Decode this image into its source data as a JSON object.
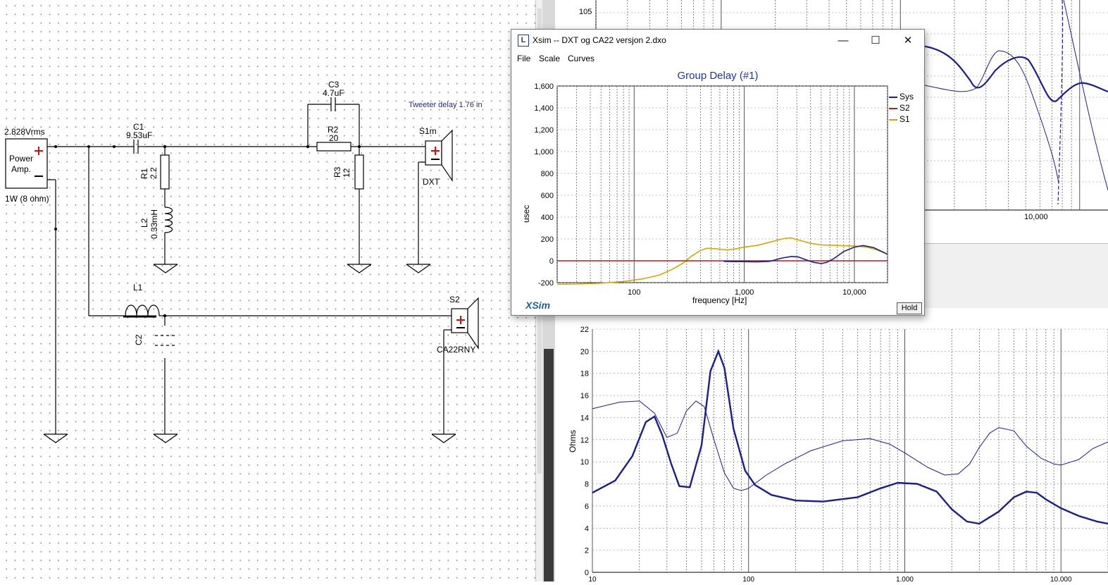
{
  "schematic": {
    "source": {
      "voltage": "2.828Vrms",
      "name_line1": "Power",
      "name_line2": "Amp.",
      "rating": "1W (8 ohm)"
    },
    "components": {
      "c1_name": "C1",
      "c1_value": "9.53uF",
      "c3_name": "C3",
      "c3_value": "4.7uF",
      "r2_name": "R2",
      "r2_value": "20",
      "r1_name": "R1",
      "r1_value": "2.2",
      "r3_name": "R3",
      "r3_value": "12",
      "l2_name": "L2",
      "l2_value": "0.33mH",
      "l1_name": "L1",
      "c2_name": "C2"
    },
    "drivers": {
      "s1_name": "S1m",
      "s1_model": "DXT",
      "s2_name": "S2",
      "s2_model": "CA22RNY"
    },
    "note": "Tweeter delay 1.76 in"
  },
  "top_chart": {
    "y_tick_label": "105",
    "x_tick_label": "10,000"
  },
  "bottom_chart": {
    "ylabel": "Ohms",
    "y_ticks": [
      "0",
      "2",
      "4",
      "6",
      "8",
      "10",
      "12",
      "14",
      "16",
      "18",
      "20",
      "22"
    ],
    "x_ticks": [
      "10",
      "100",
      "1,000",
      "10,000"
    ],
    "chart_data": {
      "type": "line",
      "xscale": "log",
      "xlim": [
        10,
        20000
      ],
      "ylim": [
        0,
        22
      ],
      "ylabel": "Ohms",
      "series": [
        {
          "style": "thick",
          "x": [
            10,
            14,
            18,
            22,
            25,
            28,
            32,
            36,
            42,
            50,
            57,
            64,
            70,
            80,
            95,
            110,
            140,
            200,
            300,
            500,
            700,
            900,
            1200,
            1600,
            2000,
            2500,
            3000,
            4000,
            5000,
            6000,
            7000,
            8000,
            10000,
            13000,
            17000,
            20000
          ],
          "values": [
            7.2,
            8.3,
            10.5,
            13.6,
            14.1,
            12.4,
            9.8,
            7.8,
            7.7,
            11.5,
            18.2,
            20.0,
            18.5,
            13.0,
            9.2,
            7.9,
            7.0,
            6.5,
            6.4,
            6.8,
            7.6,
            8.1,
            8.0,
            7.3,
            5.7,
            4.6,
            4.4,
            5.5,
            6.8,
            7.3,
            7.2,
            6.6,
            5.8,
            5.1,
            4.6,
            4.4
          ]
        },
        {
          "style": "thin",
          "x": [
            10,
            15,
            20,
            25,
            30,
            35,
            40,
            46,
            52,
            60,
            70,
            80,
            90,
            100,
            130,
            170,
            250,
            400,
            600,
            800,
            1000,
            1400,
            1800,
            2200,
            2600,
            3000,
            3500,
            4000,
            5000,
            6000,
            7500,
            9000,
            10000,
            13000,
            16000,
            20000
          ],
          "values": [
            14.8,
            15.4,
            15.5,
            14.4,
            12.2,
            12.6,
            14.6,
            15.5,
            15.0,
            12.0,
            9.0,
            7.6,
            7.4,
            7.6,
            8.8,
            9.8,
            11.0,
            11.9,
            12.1,
            11.6,
            10.8,
            9.5,
            8.8,
            8.9,
            9.8,
            11.3,
            12.6,
            13.1,
            12.8,
            11.4,
            10.3,
            9.8,
            9.7,
            10.2,
            11.2,
            11.8
          ]
        }
      ]
    }
  },
  "dialog": {
    "title": "Xsim -- DXT og CA22 versjon 2.dxo",
    "menu": [
      "File",
      "Scale",
      "Curves"
    ],
    "logo": "XSim",
    "hold": "Hold",
    "chart_data": {
      "type": "line",
      "title": "Group Delay (#1)",
      "xlabel": "frequency [Hz]",
      "ylabel": "usec",
      "xscale": "log",
      "xlim": [
        20,
        20000
      ],
      "ylim": [
        -200,
        1600
      ],
      "x_ticks": [
        "100",
        "1,000",
        "10,000"
      ],
      "y_ticks": [
        "-200",
        "0",
        "200",
        "400",
        "600",
        "800",
        "1,000",
        "1,200",
        "1,400",
        "1,600"
      ],
      "legend": "top-right",
      "series": [
        {
          "name": "Sys",
          "color": "#1a1f8f",
          "x": [
            650,
            800,
            1000,
            1300,
            1700,
            2200,
            2700,
            3100,
            3600,
            4300,
            5000,
            5600,
            6500,
            8000,
            10000,
            12000,
            15000,
            20000
          ],
          "values": [
            -5,
            -8,
            -8,
            -10,
            -5,
            25,
            40,
            35,
            10,
            -15,
            -25,
            -15,
            20,
            85,
            125,
            140,
            120,
            60
          ]
        },
        {
          "name": "S2",
          "color": "#b22222",
          "x": [
            20,
            20000
          ],
          "values": [
            0,
            0
          ]
        },
        {
          "name": "S1",
          "color": "#d4a800",
          "x": [
            20,
            30,
            50,
            80,
            120,
            170,
            220,
            280,
            330,
            400,
            460,
            550,
            700,
            850,
            1000,
            1300,
            1700,
            2200,
            2600,
            3000,
            4000,
            5000,
            7000,
            10000,
            13000,
            16000,
            20000
          ],
          "values": [
            -215,
            -213,
            -205,
            -190,
            -165,
            -130,
            -80,
            -20,
            40,
            95,
            115,
            110,
            100,
            110,
            125,
            140,
            170,
            200,
            210,
            195,
            160,
            145,
            140,
            135,
            125,
            100,
            60
          ]
        }
      ]
    }
  },
  "colors": {
    "curve_blue": "#1a1f8f",
    "s2_red": "#b22222",
    "s1_yellow": "#d4a800",
    "title_blue": "#1f34a6"
  }
}
